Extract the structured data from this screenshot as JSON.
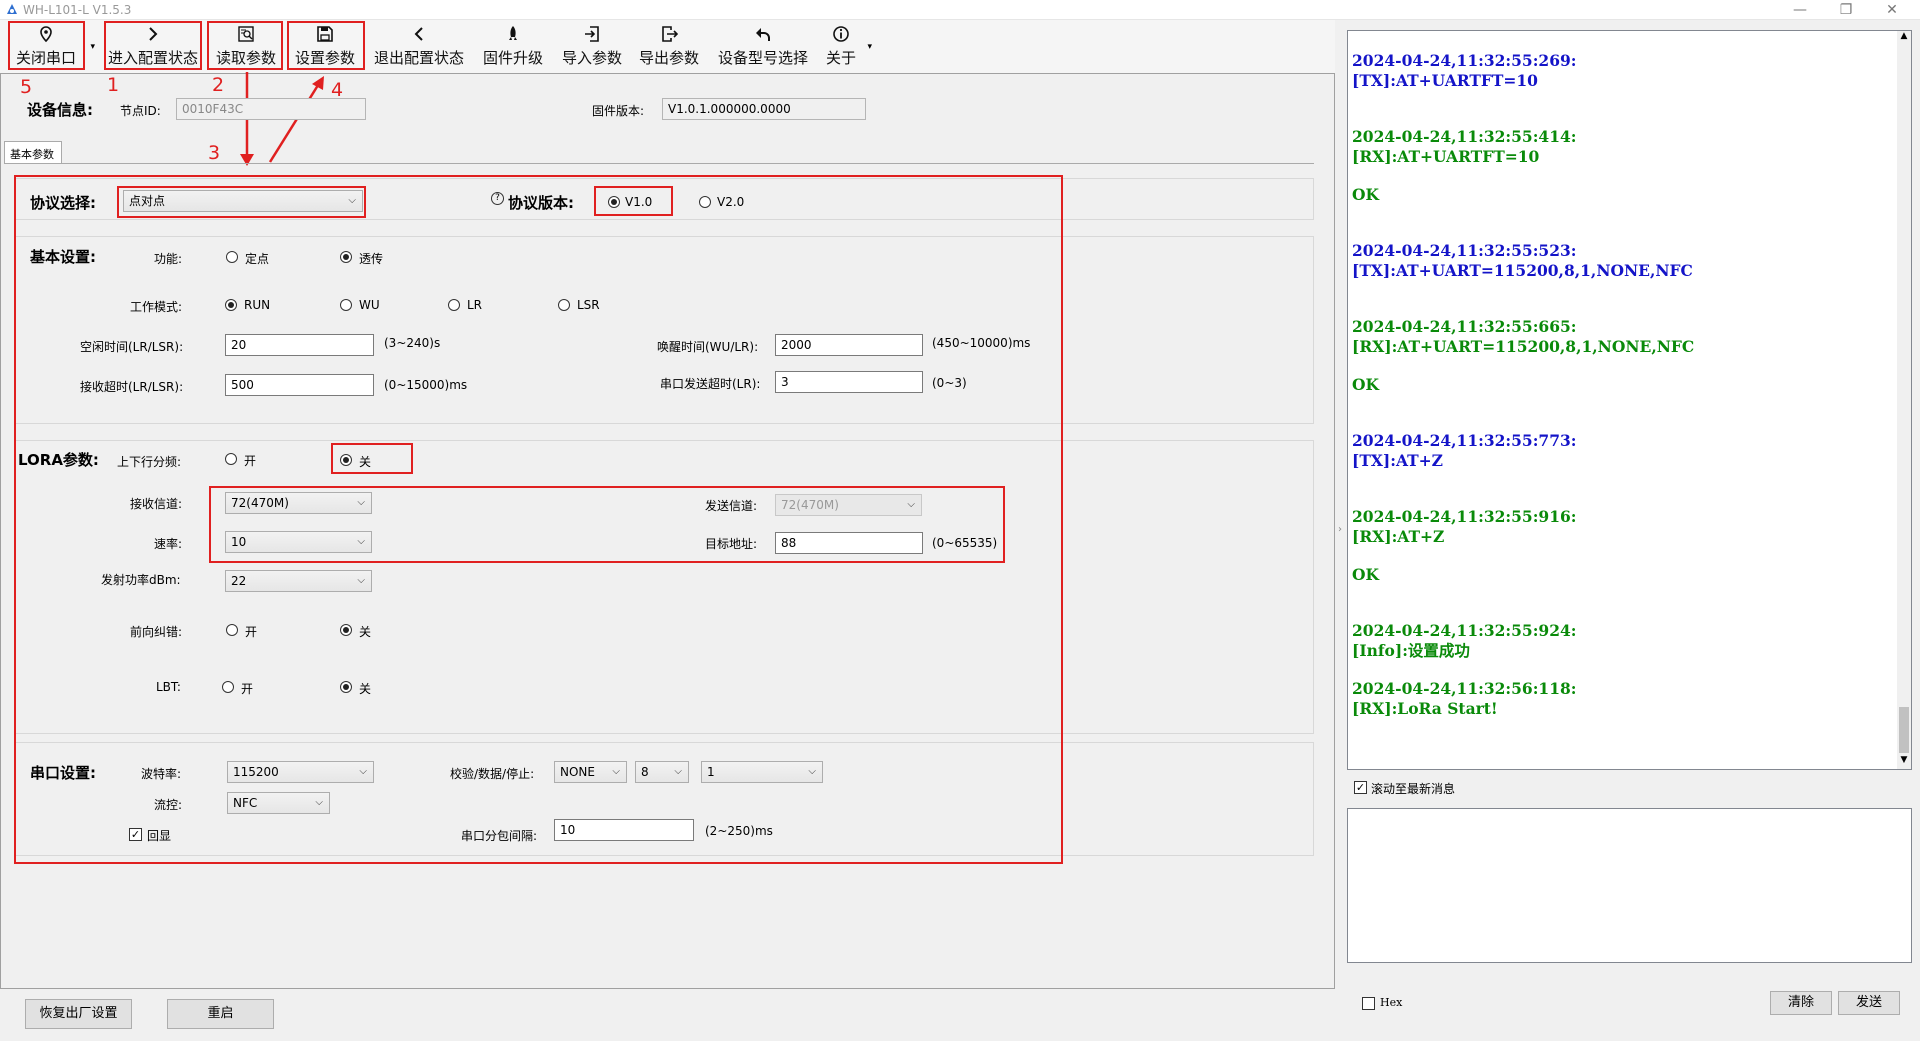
{
  "window": {
    "title": "WH-L101-L V1.5.3",
    "min": "—",
    "restore": "❐",
    "close": "✕"
  },
  "toolbar": {
    "close_port": "关闭串口",
    "enter_config": "进入配置状态",
    "read_params": "读取参数",
    "set_params": "设置参数",
    "exit_config": "退出配置状态",
    "firmware_upgrade": "固件升级",
    "import_params": "导入参数",
    "export_params": "导出参数",
    "device_model": "设备型号选择",
    "about": "关于",
    "dropdown": "▾"
  },
  "annotations": {
    "n1": "1",
    "n2": "2",
    "n3": "3",
    "n4": "4",
    "n5": "5"
  },
  "device_info": {
    "title": "设备信息:",
    "node_id_label": "节点ID:",
    "node_id": "0010F43C",
    "fw_label": "固件版本:",
    "fw_version": "V1.0.1.000000.0000"
  },
  "tab": {
    "label": "基本参数"
  },
  "protocol": {
    "label": "协议选择:",
    "value": "点对点",
    "version_label": "协议版本:",
    "help": "?",
    "v1": "V1.0",
    "v2": "V2.0"
  },
  "basic": {
    "title": "基本设置:",
    "function_label": "功能:",
    "fixed": "定点",
    "transparent": "透传",
    "mode_label": "工作模式:",
    "modes": [
      "RUN",
      "WU",
      "LR",
      "LSR"
    ],
    "idle_label": "空闲时间(LR/LSR):",
    "idle_value": "20",
    "idle_range": "(3~240)s",
    "wake_label": "唤醒时间(WU/LR):",
    "wake_value": "2000",
    "wake_range": "(450~10000)ms",
    "rx_timeout_label": "接收超时(LR/LSR):",
    "rx_timeout_value": "500",
    "rx_timeout_range": "(0~15000)ms",
    "tx_timeout_label": "串口发送超时(LR):",
    "tx_timeout_value": "3",
    "tx_timeout_range": "(0~3)"
  },
  "lora": {
    "title": "LORA参数:",
    "split_label": "上下行分频:",
    "on": "开",
    "off": "关",
    "rx_channel_label": "接收信道:",
    "rx_channel": "72(470M)",
    "tx_channel_label": "发送信道:",
    "tx_channel": "72(470M)",
    "rate_label": "速率:",
    "rate": "10",
    "target_label": "目标地址:",
    "target": "88",
    "target_range": "(0~65535)",
    "power_label": "发射功率dBm:",
    "power": "22",
    "fec_label": "前向纠错:",
    "lbt_label": "LBT:"
  },
  "serial": {
    "title": "串口设置:",
    "baud_label": "波特率:",
    "baud": "115200",
    "parity_label": "校验/数据/停止:",
    "parity": "NONE",
    "data_bits": "8",
    "stop_bits": "1",
    "flow_label": "流控:",
    "flow": "NFC",
    "echo_label": "回显",
    "interval_label": "串口分包间隔:",
    "interval": "10",
    "interval_range": "(2~250)ms"
  },
  "bottom": {
    "factory_reset": "恢复出厂设置",
    "restart": "重启"
  },
  "log": [
    {
      "text": "2024-04-24,11:32:55:269:",
      "color": "blue"
    },
    {
      "text": "[TX]:AT+UARTFT=10",
      "color": "blue"
    },
    {
      "text": "2024-04-24,11:32:55:414:",
      "color": "green"
    },
    {
      "text": "[RX]:AT+UARTFT=10",
      "color": "green"
    },
    {
      "text": "OK",
      "color": "green"
    },
    {
      "text": "2024-04-24,11:32:55:523:",
      "color": "blue"
    },
    {
      "text": "[TX]:AT+UART=115200,8,1,NONE,NFC",
      "color": "blue"
    },
    {
      "text": "2024-04-24,11:32:55:665:",
      "color": "green"
    },
    {
      "text": "[RX]:AT+UART=115200,8,1,NONE,NFC",
      "color": "green"
    },
    {
      "text": "OK",
      "color": "green"
    },
    {
      "text": "2024-04-24,11:32:55:773:",
      "color": "blue"
    },
    {
      "text": "[TX]:AT+Z",
      "color": "blue"
    },
    {
      "text": "2024-04-24,11:32:55:916:",
      "color": "green"
    },
    {
      "text": "[RX]:AT+Z",
      "color": "green"
    },
    {
      "text": "OK",
      "color": "green"
    },
    {
      "text": "2024-04-24,11:32:55:924:",
      "color": "green"
    },
    {
      "text": "[Info]:设置成功",
      "color": "green"
    },
    {
      "text": "2024-04-24,11:32:56:118:",
      "color": "green"
    },
    {
      "text": "[RX]:LoRa Start!",
      "color": "green"
    }
  ],
  "right": {
    "autoscroll": "滚动至最新消息",
    "hex": "Hex",
    "clear": "清除",
    "send": "发送"
  },
  "colors": {
    "annotation_red": "#e02020",
    "log_blue": "#1414c8",
    "log_green": "#0a8a0a"
  }
}
